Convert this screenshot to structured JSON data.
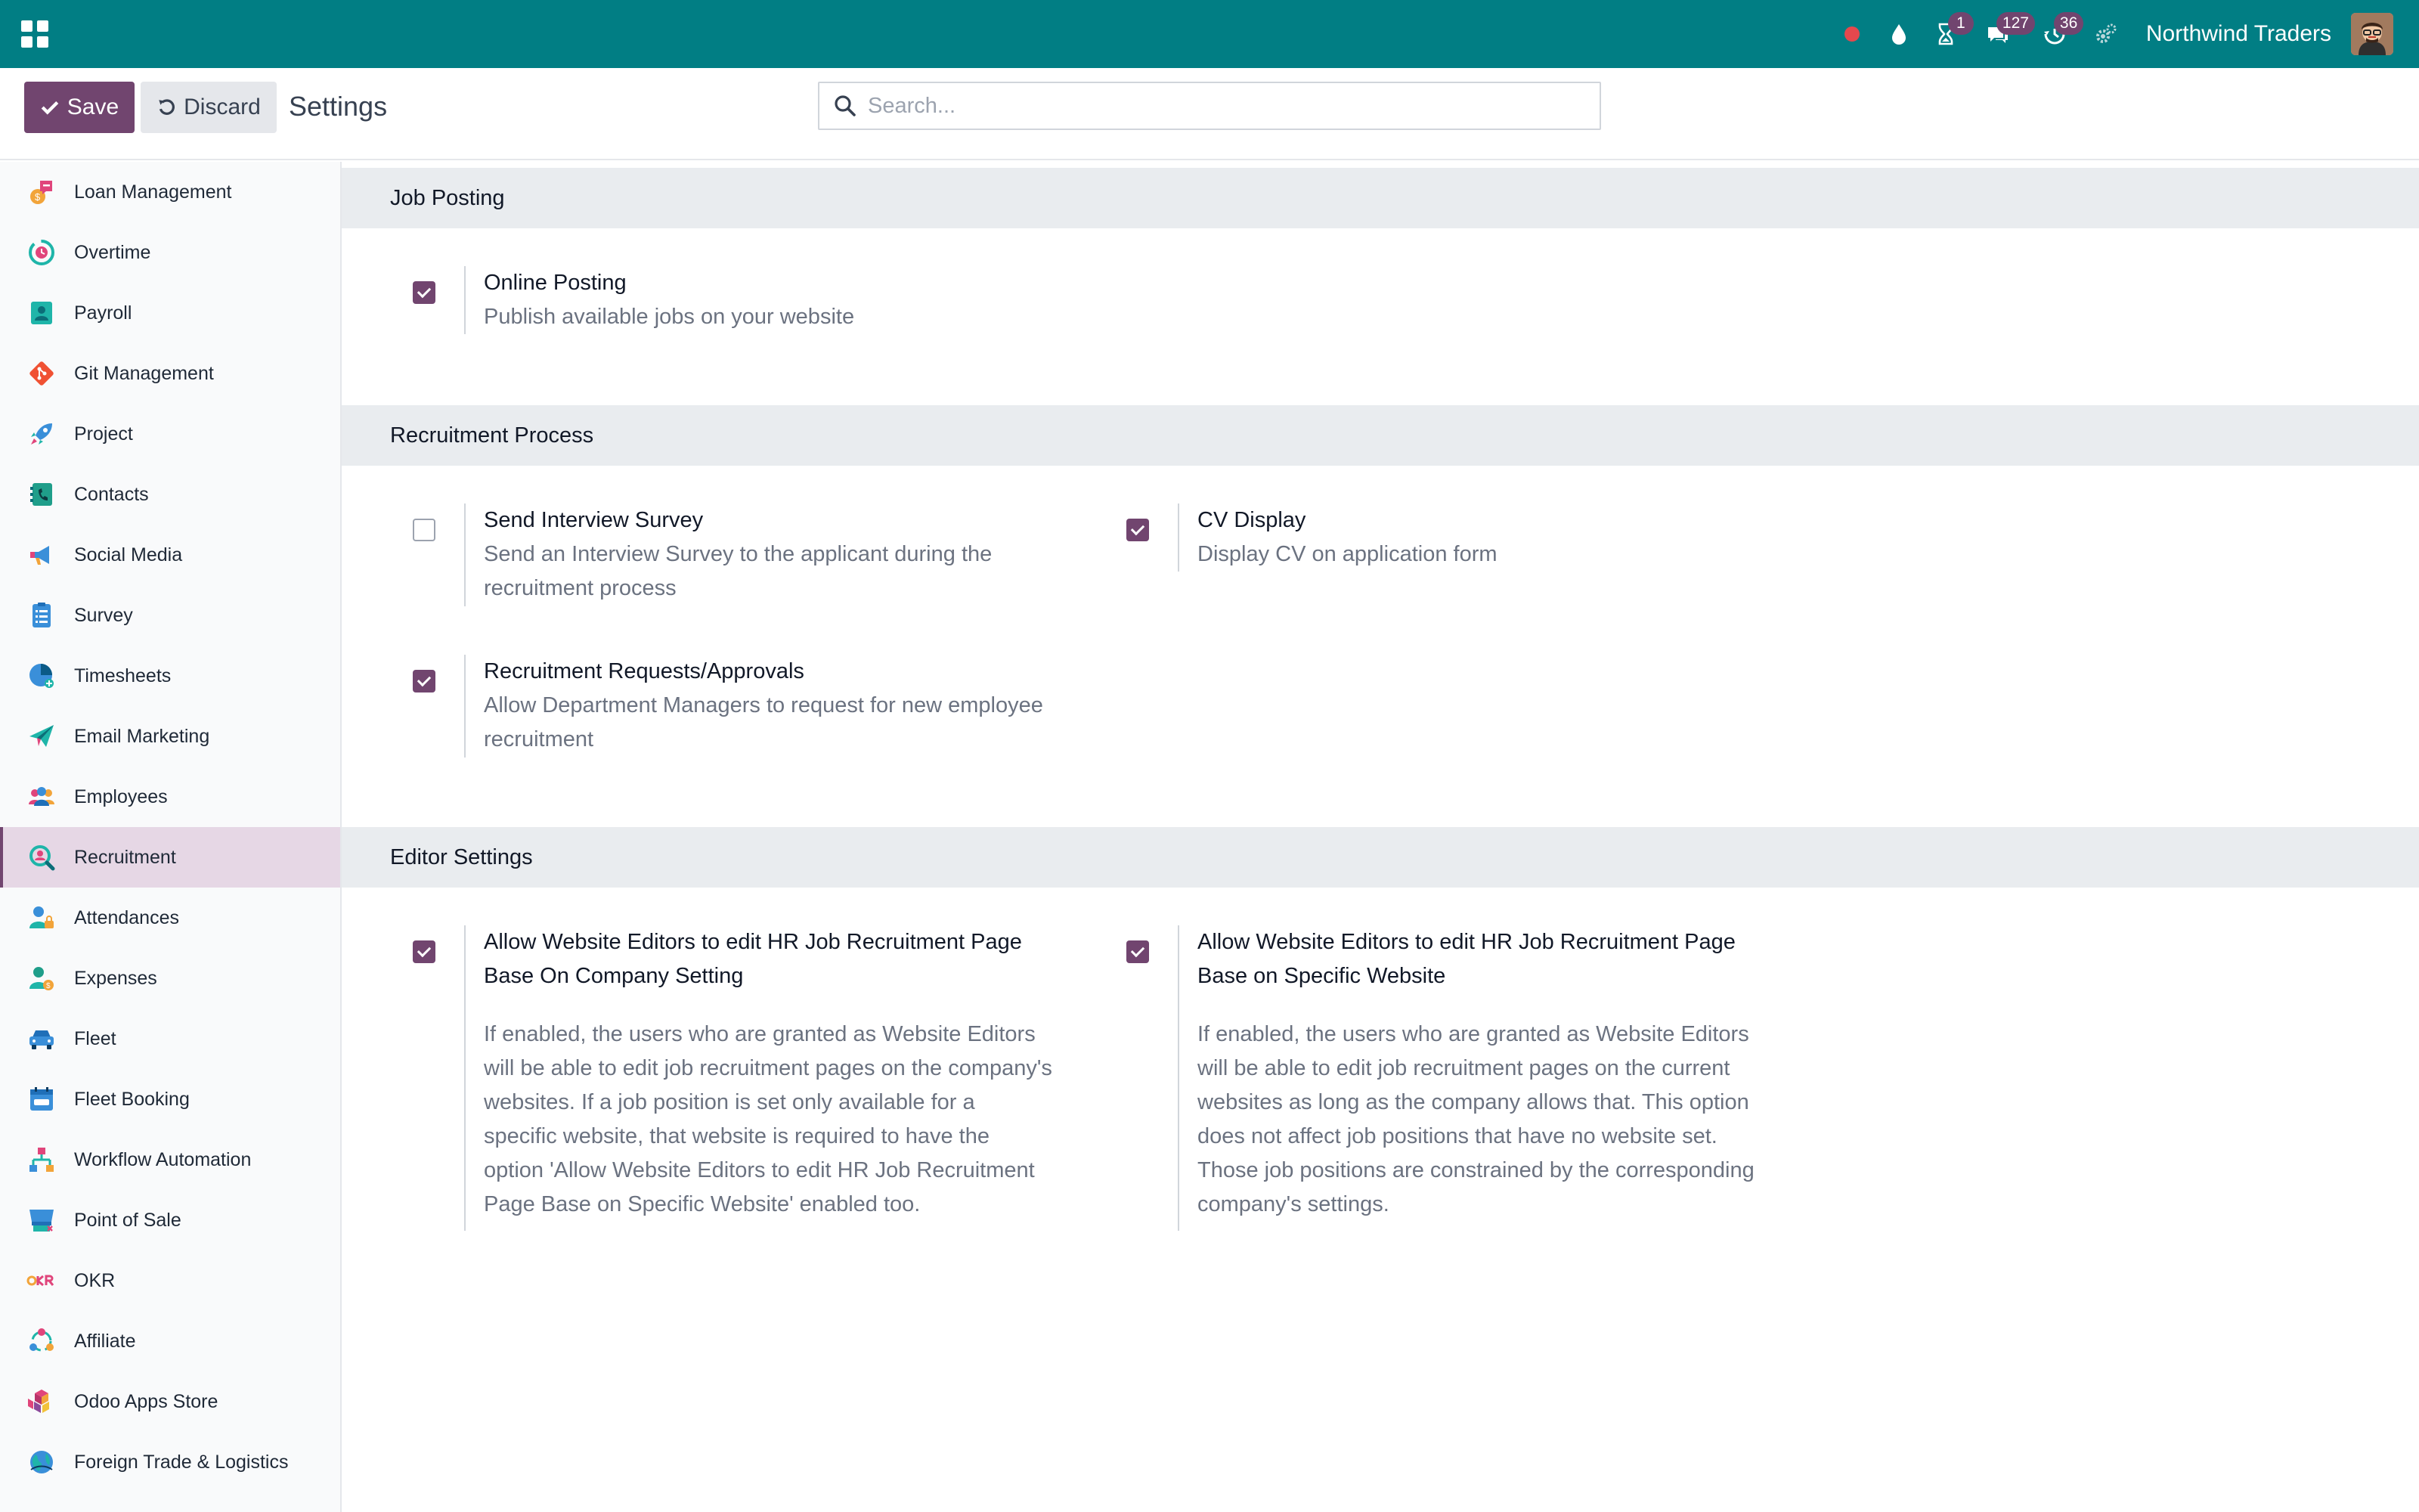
{
  "navbar": {
    "company": "Northwind Traders",
    "badges": {
      "activities": "1",
      "messages": "127",
      "timesheet": "36"
    }
  },
  "control": {
    "save_label": "Save",
    "discard_label": "Discard",
    "title": "Settings",
    "search_placeholder": "Search..."
  },
  "sidebar": {
    "items": [
      {
        "label": "Loan Management",
        "icon": "loan-icon"
      },
      {
        "label": "Overtime",
        "icon": "overtime-icon"
      },
      {
        "label": "Payroll",
        "icon": "payroll-icon"
      },
      {
        "label": "Git Management",
        "icon": "git-icon"
      },
      {
        "label": "Project",
        "icon": "rocket-icon"
      },
      {
        "label": "Contacts",
        "icon": "contacts-icon"
      },
      {
        "label": "Social Media",
        "icon": "megaphone-icon"
      },
      {
        "label": "Survey",
        "icon": "survey-icon"
      },
      {
        "label": "Timesheets",
        "icon": "timesheets-icon"
      },
      {
        "label": "Email Marketing",
        "icon": "paper-plane-icon"
      },
      {
        "label": "Employees",
        "icon": "employees-icon"
      },
      {
        "label": "Recruitment",
        "icon": "recruitment-icon",
        "active": true
      },
      {
        "label": "Attendances",
        "icon": "attendances-icon"
      },
      {
        "label": "Expenses",
        "icon": "expenses-icon"
      },
      {
        "label": "Fleet",
        "icon": "car-icon"
      },
      {
        "label": "Fleet Booking",
        "icon": "fleet-booking-icon"
      },
      {
        "label": "Workflow Automation",
        "icon": "workflow-icon"
      },
      {
        "label": "Point of Sale",
        "icon": "pos-icon"
      },
      {
        "label": "OKR",
        "icon": "okr-icon"
      },
      {
        "label": "Affiliate",
        "icon": "affiliate-icon"
      },
      {
        "label": "Odoo Apps Store",
        "icon": "apps-store-icon"
      },
      {
        "label": "Foreign Trade & Logistics",
        "icon": "globe-icon"
      }
    ]
  },
  "sections": {
    "job_posting": {
      "title": "Job Posting",
      "online_posting": {
        "title": "Online Posting",
        "desc": "Publish available jobs on your website",
        "checked": true
      }
    },
    "recruitment_process": {
      "title": "Recruitment Process",
      "interview_survey": {
        "title": "Send Interview Survey",
        "desc1": "Send an Interview Survey to the applicant during the",
        "desc2": "recruitment process",
        "checked": false
      },
      "cv_display": {
        "title": "CV Display",
        "desc": "Display CV on application form",
        "checked": true
      },
      "requests": {
        "title": "Recruitment Requests/Approvals",
        "desc1": "Allow Department Managers to request for new employee",
        "desc2": "recruitment",
        "checked": true
      }
    },
    "editor_settings": {
      "title": "Editor Settings",
      "company_setting": {
        "title1": "Allow Website Editors to edit HR Job Recruitment Page",
        "title2": "Base On Company Setting",
        "lines": [
          "If enabled, the users who are granted as Website Editors",
          "will be able to edit job recruitment pages on the company's",
          "websites. If a job position is set only available for a",
          "specific website, that website is required to have the",
          "option 'Allow Website Editors to edit HR Job Recruitment",
          "Page Base on Specific Website' enabled too."
        ],
        "checked": true
      },
      "website_setting": {
        "title1": "Allow Website Editors to edit HR Job Recruitment Page",
        "title2": "Base on Specific Website",
        "lines": [
          "If enabled, the users who are granted as Website Editors",
          "will be able to edit job recruitment pages on the current",
          "websites as long as the company allows that. This option",
          "does not affect job positions that have no website set.",
          "Those job positions are constrained by the corresponding",
          "company's settings."
        ],
        "checked": true
      }
    }
  },
  "colors": {
    "navbar": "#017e84",
    "accent": "#71456f",
    "section_bg": "#e9ecef"
  }
}
